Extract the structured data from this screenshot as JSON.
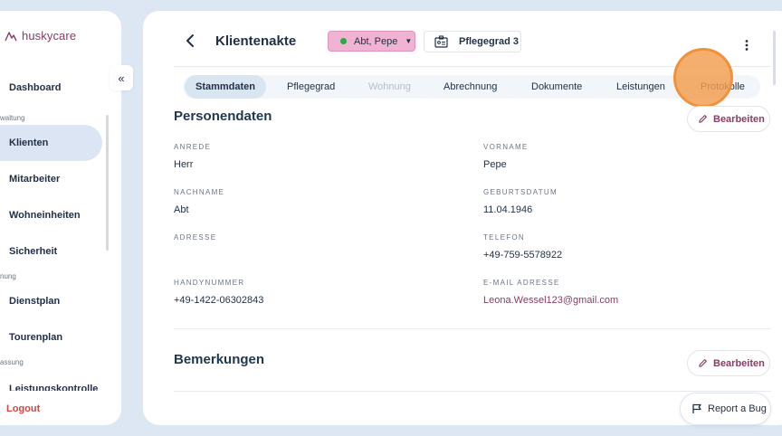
{
  "app": {
    "name": "huskycare",
    "brand_color": "#8a3c66"
  },
  "sidebar": {
    "items": [
      {
        "label": "Dashboard"
      },
      {
        "label": "Klienten",
        "active": true
      },
      {
        "label": "Mitarbeiter"
      },
      {
        "label": "Wohneinheiten"
      },
      {
        "label": "Sicherheit"
      },
      {
        "label": "Dienstplan"
      },
      {
        "label": "Tourenplan"
      },
      {
        "label": "Leistungskontrolle"
      }
    ],
    "sections": [
      "waltung",
      "nung",
      "assung"
    ],
    "logout": "Logout",
    "collapse_icon": "«"
  },
  "header": {
    "title": "Klientenakte",
    "client_select": "Abt, Pepe",
    "pflegegrad": "Pflegegrad 3"
  },
  "tabs": [
    {
      "label": "Stammdaten",
      "active": true
    },
    {
      "label": "Pflegegrad"
    },
    {
      "label": "Wohnung",
      "disabled": true
    },
    {
      "label": "Abrechnung"
    },
    {
      "label": "Dokumente"
    },
    {
      "label": "Leistungen"
    },
    {
      "label": "Protokolle"
    }
  ],
  "personendaten": {
    "title": "Personendaten",
    "edit_label": "Bearbeiten",
    "fields": {
      "anrede": {
        "label": "Anrede",
        "value": "Herr"
      },
      "vorname": {
        "label": "Vorname",
        "value": "Pepe"
      },
      "nachname": {
        "label": "Nachname",
        "value": "Abt"
      },
      "geburtsdatum": {
        "label": "Geburtsdatum",
        "value": "11.04.1946"
      },
      "adresse": {
        "label": "Adresse",
        "value": ""
      },
      "telefon": {
        "label": "Telefon",
        "value": "+49-759-5578922"
      },
      "handynummer": {
        "label": "Handynummer",
        "value": "+49-1422-06302843"
      },
      "email": {
        "label": "E-Mail Adresse",
        "value": "Leona.Wessel123@gmail.com"
      }
    }
  },
  "bemerkungen": {
    "title": "Bemerkungen",
    "edit_label": "Bearbeiten"
  },
  "report_bug": "Report a Bug",
  "icons": [
    "logo-icon",
    "back-icon",
    "id-card-icon",
    "kebab-icon",
    "pencil-icon",
    "bug-report-icon"
  ]
}
